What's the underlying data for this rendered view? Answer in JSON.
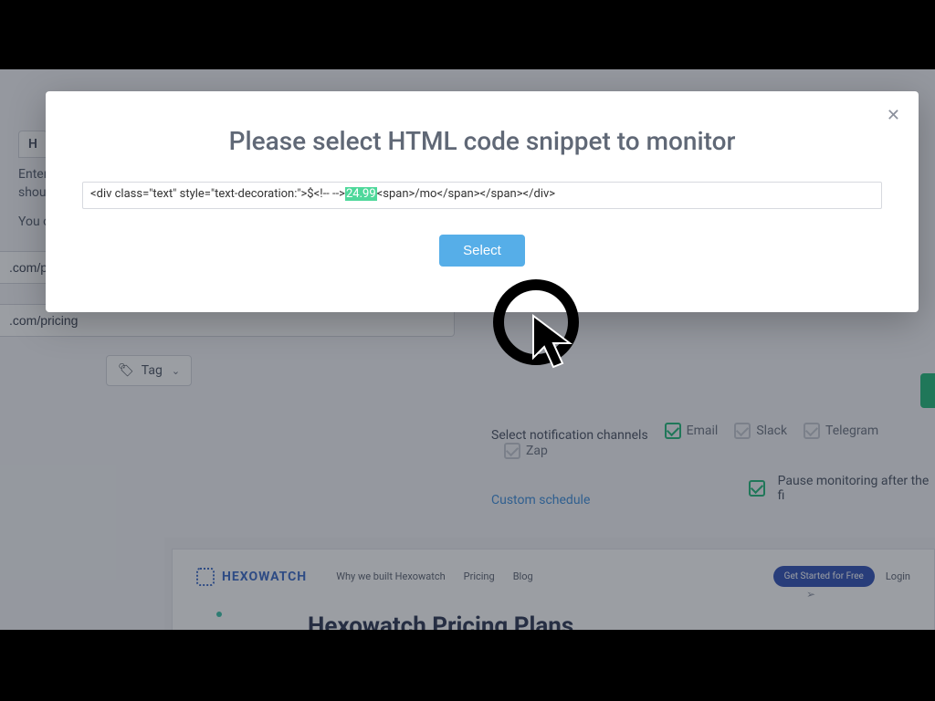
{
  "modal": {
    "title": "Please select HTML code snippet to monitor",
    "close_glyph": "✕",
    "snippet_prefix": "<div class=\"text\" style=\"text-decoration:\">$<!-- -->",
    "snippet_highlight": "24.99",
    "snippet_suffix": "<span>/mo</span></span></div>",
    "select_label": "Select"
  },
  "bg": {
    "tab_label": "H",
    "line1": "Enter",
    "line2": "shoul",
    "line3": "You c",
    "url1": ".com/pr",
    "url2": ".com/pricing",
    "notif_label": "Select notification channels",
    "channels": [
      {
        "label": "Email",
        "checked": true,
        "muted": false
      },
      {
        "label": "Slack",
        "checked": true,
        "muted": true
      },
      {
        "label": "Telegram",
        "checked": true,
        "muted": true
      },
      {
        "label": "Zap",
        "checked": true,
        "muted": true
      }
    ],
    "custom_schedule": "Custom schedule",
    "pause_label": "Pause monitoring after the fi",
    "tag_label": "Tag"
  },
  "embed": {
    "brand": "HEXOWATCH",
    "nav": [
      "Why we built Hexowatch",
      "Pricing",
      "Blog"
    ],
    "cta": "Get Started for Free",
    "login": "Login",
    "title": "Hexowatch Pricing Plans"
  }
}
